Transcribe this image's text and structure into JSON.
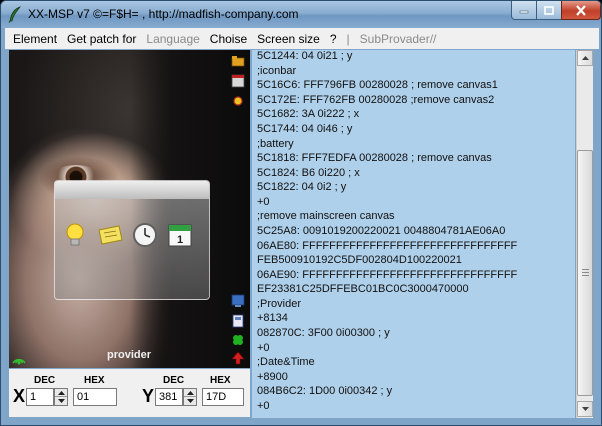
{
  "window": {
    "title": "XX-MSP v7  ©=F$H= , http://madfish-company.com"
  },
  "menu": {
    "items": [
      {
        "label": "Element",
        "enabled": true
      },
      {
        "label": "Get patch for",
        "enabled": true
      },
      {
        "label": "Language",
        "enabled": false
      },
      {
        "label": "Choise",
        "enabled": true
      },
      {
        "label": "Screen size",
        "enabled": true
      },
      {
        "label": "?",
        "enabled": true
      },
      {
        "label": "|",
        "enabled": false
      },
      {
        "label": "SubProvader//",
        "enabled": false
      }
    ]
  },
  "preview": {
    "provider_label": "provider",
    "status_icons": [
      "folder-icon",
      "window-icon",
      "sun-icon",
      "network-icon",
      "phone-icon",
      "clover-icon",
      "alert-icon"
    ],
    "widget_icons": [
      "lightbulb-icon",
      "note-icon",
      "clock-icon",
      "calendar-icon"
    ],
    "calendar_day": "1"
  },
  "coords": {
    "x": {
      "letter": "X",
      "dec_label": "DEC",
      "hex_label": "HEX",
      "dec": "1",
      "hex": "01"
    },
    "y": {
      "letter": "Y",
      "dec_label": "DEC",
      "hex_label": "HEX",
      "dec": "381",
      "hex": "17D"
    }
  },
  "patch": {
    "lines": [
      "5C1244: 04 0i21 ; y",
      ";iconbar",
      "5C16C6: FFF796FB 00280028 ; remove canvas1",
      "5C172E: FFF762FB 00280028 ;remove canvas2",
      "5C1682: 3A 0i222 ; x",
      "5C1744: 04 0i46 ; y",
      ";battery",
      "5C1818: FFF7EDFA 00280028 ; remove canvas",
      "5C1824: B6 0i220 ; x",
      "5C1822: 04 0i2 ; y",
      "+0",
      ";remove mainscreen canvas",
      "5C25A8: 0091019200220021 0048804781AE06A0",
      "06AE80: FFFFFFFFFFFFFFFFFFFFFFFFFFFFFFFF",
      "FEB500910192C5DF002804D100220021",
      "06AE90: FFFFFFFFFFFFFFFFFFFFFFFFFFFFFFFF",
      "EF23381C25DFFEBC01BC0C3000470000",
      ";Provider",
      "+8134",
      "082870C: 3F00 0i00300 ; y",
      "+0",
      ";Date&Time",
      "+8900",
      "084B6C2: 1D00 0i00342 ; y",
      "+0"
    ]
  }
}
